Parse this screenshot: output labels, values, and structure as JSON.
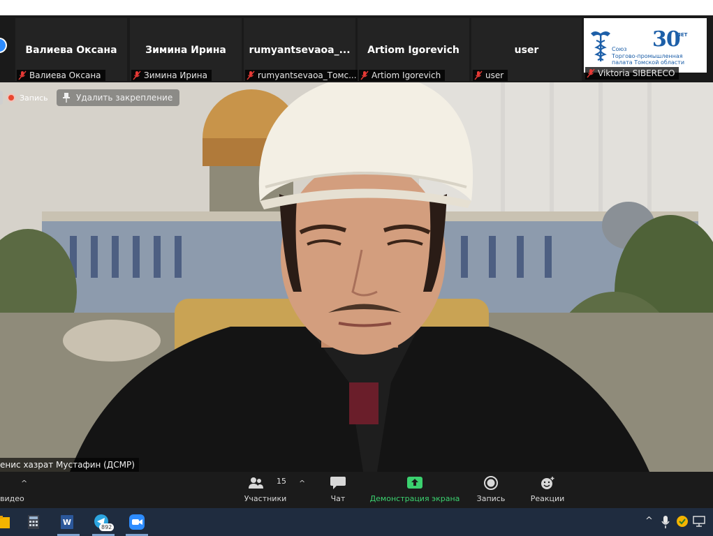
{
  "participants": [
    {
      "name": "Валиева Оксана",
      "label": "Валиева Оксана"
    },
    {
      "name": "Зимина Ирина",
      "label": "Зимина Ирина"
    },
    {
      "name": "rumyantsevaoa_...",
      "label": "rumyantsevaoa_Томс..."
    },
    {
      "name": "Artiom Igorevich",
      "label": "Artiom Igorevich"
    },
    {
      "name": "user",
      "label": "user"
    }
  ],
  "logo": {
    "number": "30",
    "number_suffix": "ЛЕТ",
    "org_line1": "Союз",
    "org_line2": "Торгово-промышленная",
    "org_line3": "палата Томской области",
    "participant_label": "Viktoria SIBERECO"
  },
  "main": {
    "recording_label": "Запись",
    "unpin_label": "Удалить закрепление",
    "speaker_name": "енис хазрат Мустафин (ДСМР)"
  },
  "toolbar": {
    "video_label": "видео",
    "participants_label": "Участники",
    "participants_count": "15",
    "chat_label": "Чат",
    "share_label": "Демонстрация экрана",
    "record_label": "Запись",
    "reactions_label": "Реакции"
  },
  "taskbar": {
    "telegram_badge": "892"
  },
  "colors": {
    "zoom_blue": "#2d8cff",
    "share_green": "#3bd16f",
    "muted_red": "#e53935",
    "logo_blue": "#1d5fa8"
  }
}
